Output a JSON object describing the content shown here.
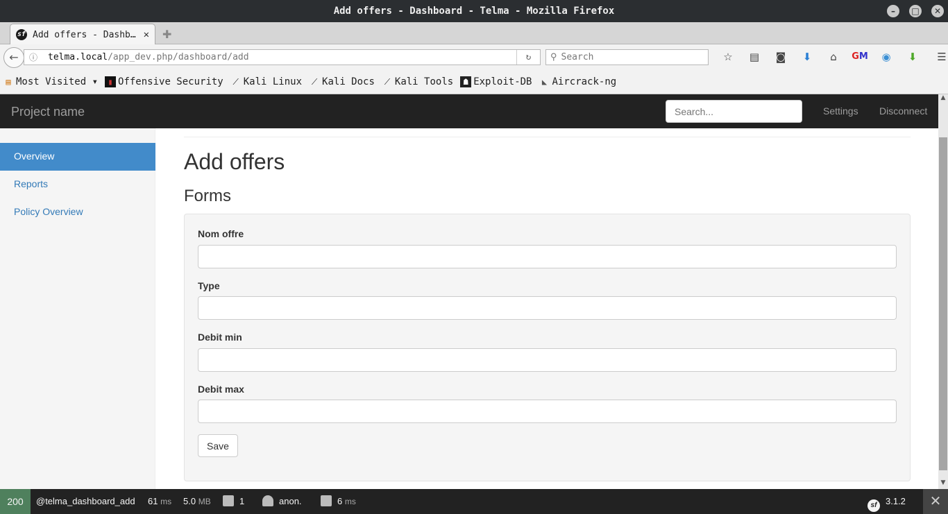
{
  "window": {
    "title": "Add offers - Dashboard - Telma - Mozilla Firefox"
  },
  "browser": {
    "tab_title": "Add offers - Dashb…",
    "url_host": "telma.local",
    "url_path": "/app_dev.php/dashboard/add",
    "search_placeholder": "Search"
  },
  "bookmarks": [
    {
      "label": "Most Visited ▾",
      "icon": "folder-icon"
    },
    {
      "label": "Offensive Security",
      "icon": "offsec-icon"
    },
    {
      "label": "Kali Linux",
      "icon": "kali-icon"
    },
    {
      "label": "Kali Docs",
      "icon": "kali-icon"
    },
    {
      "label": "Kali Tools",
      "icon": "kali-icon"
    },
    {
      "label": "Exploit-DB",
      "icon": "exploitdb-icon"
    },
    {
      "label": "Aircrack-ng",
      "icon": "aircrack-icon"
    }
  ],
  "app": {
    "brand": "Project name",
    "search_placeholder": "Search...",
    "nav_settings": "Settings",
    "nav_disconnect": "Disconnect"
  },
  "sidebar": {
    "items": [
      {
        "label": "Overview",
        "active": true
      },
      {
        "label": "Reports",
        "active": false
      },
      {
        "label": "Policy Overview",
        "active": false
      }
    ]
  },
  "main": {
    "heading": "Add offers",
    "subheading": "Forms",
    "fields": [
      {
        "label": "Nom offre",
        "value": ""
      },
      {
        "label": "Type",
        "value": ""
      },
      {
        "label": "Debit min",
        "value": ""
      },
      {
        "label": "Debit max",
        "value": ""
      }
    ],
    "save_label": "Save"
  },
  "sf_toolbar": {
    "status_code": "200",
    "route": "@telma_dashboard_add",
    "time_value": "61",
    "time_unit": "ms",
    "memory_value": "5.0",
    "memory_unit": "MB",
    "forms_count": "1",
    "user": "anon.",
    "twig_value": "6",
    "twig_unit": "ms",
    "version": "3.1.2",
    "status_color": "#4f805d"
  }
}
